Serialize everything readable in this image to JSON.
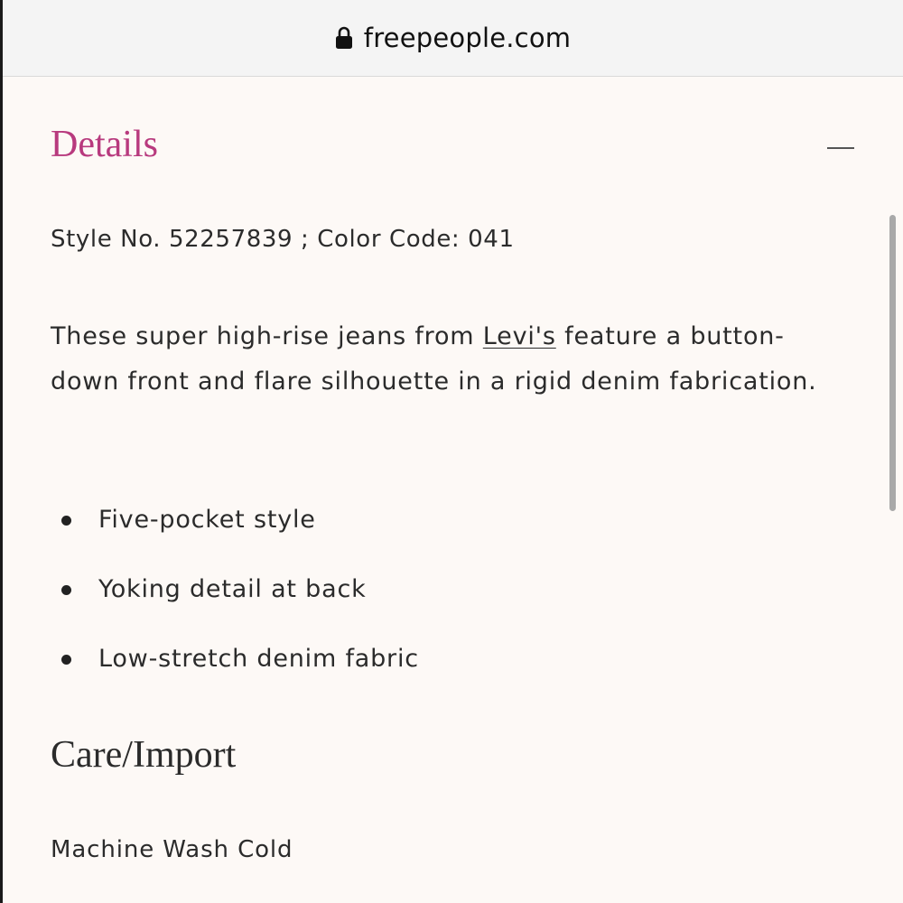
{
  "browser": {
    "url": "freepeople.com",
    "lock_icon": "lock-icon"
  },
  "details": {
    "title": "Details",
    "collapse_icon": "minus-icon",
    "style_line": "Style No. 52257839 ; Color Code: 041",
    "description_before": "These super high-rise jeans from ",
    "brand_link": "Levi's",
    "description_after": " feature a button-down front and flare silhouette in a rigid denim fabrication.",
    "features": [
      "Five-pocket style",
      "Yoking detail at back",
      "Low-stretch denim fabric"
    ]
  },
  "care": {
    "title": "Care/Import",
    "text": "Machine Wash Cold"
  },
  "colors": {
    "accent": "#b83a7e",
    "text": "#2b2b2b",
    "background": "#fdf9f6"
  }
}
